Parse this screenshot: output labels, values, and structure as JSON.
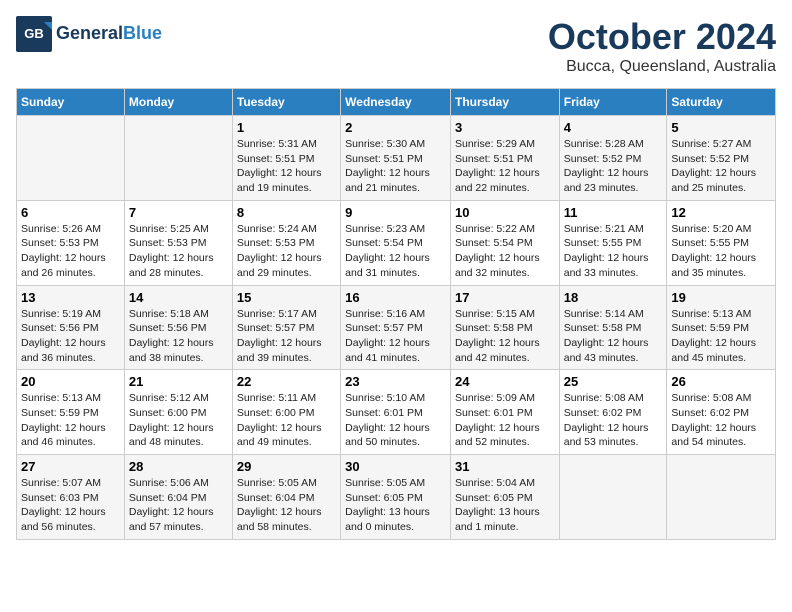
{
  "header": {
    "logo_line1": "General",
    "logo_line2": "Blue",
    "title": "October 2024",
    "subtitle": "Bucca, Queensland, Australia"
  },
  "columns": [
    "Sunday",
    "Monday",
    "Tuesday",
    "Wednesday",
    "Thursday",
    "Friday",
    "Saturday"
  ],
  "weeks": [
    {
      "cells": [
        {
          "day": null,
          "info": null
        },
        {
          "day": null,
          "info": null
        },
        {
          "day": "1",
          "info": "Sunrise: 5:31 AM\nSunset: 5:51 PM\nDaylight: 12 hours\nand 19 minutes."
        },
        {
          "day": "2",
          "info": "Sunrise: 5:30 AM\nSunset: 5:51 PM\nDaylight: 12 hours\nand 21 minutes."
        },
        {
          "day": "3",
          "info": "Sunrise: 5:29 AM\nSunset: 5:51 PM\nDaylight: 12 hours\nand 22 minutes."
        },
        {
          "day": "4",
          "info": "Sunrise: 5:28 AM\nSunset: 5:52 PM\nDaylight: 12 hours\nand 23 minutes."
        },
        {
          "day": "5",
          "info": "Sunrise: 5:27 AM\nSunset: 5:52 PM\nDaylight: 12 hours\nand 25 minutes."
        }
      ]
    },
    {
      "cells": [
        {
          "day": "6",
          "info": "Sunrise: 5:26 AM\nSunset: 5:53 PM\nDaylight: 12 hours\nand 26 minutes."
        },
        {
          "day": "7",
          "info": "Sunrise: 5:25 AM\nSunset: 5:53 PM\nDaylight: 12 hours\nand 28 minutes."
        },
        {
          "day": "8",
          "info": "Sunrise: 5:24 AM\nSunset: 5:53 PM\nDaylight: 12 hours\nand 29 minutes."
        },
        {
          "day": "9",
          "info": "Sunrise: 5:23 AM\nSunset: 5:54 PM\nDaylight: 12 hours\nand 31 minutes."
        },
        {
          "day": "10",
          "info": "Sunrise: 5:22 AM\nSunset: 5:54 PM\nDaylight: 12 hours\nand 32 minutes."
        },
        {
          "day": "11",
          "info": "Sunrise: 5:21 AM\nSunset: 5:55 PM\nDaylight: 12 hours\nand 33 minutes."
        },
        {
          "day": "12",
          "info": "Sunrise: 5:20 AM\nSunset: 5:55 PM\nDaylight: 12 hours\nand 35 minutes."
        }
      ]
    },
    {
      "cells": [
        {
          "day": "13",
          "info": "Sunrise: 5:19 AM\nSunset: 5:56 PM\nDaylight: 12 hours\nand 36 minutes."
        },
        {
          "day": "14",
          "info": "Sunrise: 5:18 AM\nSunset: 5:56 PM\nDaylight: 12 hours\nand 38 minutes."
        },
        {
          "day": "15",
          "info": "Sunrise: 5:17 AM\nSunset: 5:57 PM\nDaylight: 12 hours\nand 39 minutes."
        },
        {
          "day": "16",
          "info": "Sunrise: 5:16 AM\nSunset: 5:57 PM\nDaylight: 12 hours\nand 41 minutes."
        },
        {
          "day": "17",
          "info": "Sunrise: 5:15 AM\nSunset: 5:58 PM\nDaylight: 12 hours\nand 42 minutes."
        },
        {
          "day": "18",
          "info": "Sunrise: 5:14 AM\nSunset: 5:58 PM\nDaylight: 12 hours\nand 43 minutes."
        },
        {
          "day": "19",
          "info": "Sunrise: 5:13 AM\nSunset: 5:59 PM\nDaylight: 12 hours\nand 45 minutes."
        }
      ]
    },
    {
      "cells": [
        {
          "day": "20",
          "info": "Sunrise: 5:13 AM\nSunset: 5:59 PM\nDaylight: 12 hours\nand 46 minutes."
        },
        {
          "day": "21",
          "info": "Sunrise: 5:12 AM\nSunset: 6:00 PM\nDaylight: 12 hours\nand 48 minutes."
        },
        {
          "day": "22",
          "info": "Sunrise: 5:11 AM\nSunset: 6:00 PM\nDaylight: 12 hours\nand 49 minutes."
        },
        {
          "day": "23",
          "info": "Sunrise: 5:10 AM\nSunset: 6:01 PM\nDaylight: 12 hours\nand 50 minutes."
        },
        {
          "day": "24",
          "info": "Sunrise: 5:09 AM\nSunset: 6:01 PM\nDaylight: 12 hours\nand 52 minutes."
        },
        {
          "day": "25",
          "info": "Sunrise: 5:08 AM\nSunset: 6:02 PM\nDaylight: 12 hours\nand 53 minutes."
        },
        {
          "day": "26",
          "info": "Sunrise: 5:08 AM\nSunset: 6:02 PM\nDaylight: 12 hours\nand 54 minutes."
        }
      ]
    },
    {
      "cells": [
        {
          "day": "27",
          "info": "Sunrise: 5:07 AM\nSunset: 6:03 PM\nDaylight: 12 hours\nand 56 minutes."
        },
        {
          "day": "28",
          "info": "Sunrise: 5:06 AM\nSunset: 6:04 PM\nDaylight: 12 hours\nand 57 minutes."
        },
        {
          "day": "29",
          "info": "Sunrise: 5:05 AM\nSunset: 6:04 PM\nDaylight: 12 hours\nand 58 minutes."
        },
        {
          "day": "30",
          "info": "Sunrise: 5:05 AM\nSunset: 6:05 PM\nDaylight: 13 hours\nand 0 minutes."
        },
        {
          "day": "31",
          "info": "Sunrise: 5:04 AM\nSunset: 6:05 PM\nDaylight: 13 hours\nand 1 minute."
        },
        {
          "day": null,
          "info": null
        },
        {
          "day": null,
          "info": null
        }
      ]
    }
  ]
}
